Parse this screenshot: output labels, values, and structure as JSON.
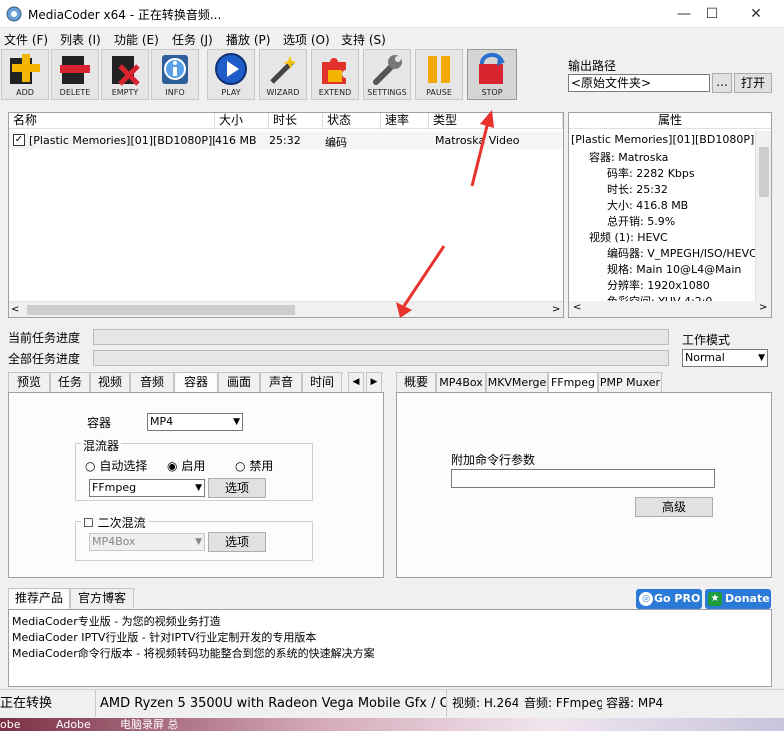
{
  "window": {
    "title": "MediaCoder x64 - 正在转换音频...",
    "controls": {
      "minimize": "—",
      "maximize": "☐",
      "close": "✕"
    }
  },
  "menu": [
    "文件 (F)",
    "列表 (I)",
    "功能 (E)",
    "任务 (J)",
    "播放 (P)",
    "选项 (O)",
    "支持 (S)"
  ],
  "toolbar": [
    {
      "label": "ADD",
      "icon": "add-icon"
    },
    {
      "label": "DELETE",
      "icon": "delete-icon"
    },
    {
      "label": "EMPTY",
      "icon": "empty-icon"
    },
    {
      "label": "INFO",
      "icon": "info-icon"
    },
    {
      "label": "PLAY",
      "icon": "play-icon"
    },
    {
      "label": "WIZARD",
      "icon": "wizard-icon"
    },
    {
      "label": "EXTEND",
      "icon": "puzzle-icon"
    },
    {
      "label": "SETTINGS",
      "icon": "wrench-icon"
    },
    {
      "label": "PAUSE",
      "icon": "pause-icon"
    },
    {
      "label": "STOP",
      "icon": "stop-icon"
    }
  ],
  "output": {
    "label": "输出路径",
    "value": "<原始文件夹>",
    "browse": "...",
    "open": "打开"
  },
  "file_list": {
    "columns": [
      "名称",
      "大小",
      "时长",
      "状态",
      "速率",
      "类型"
    ],
    "rows": [
      {
        "name": "[Plastic Memories][01][BD1080P][...",
        "size": "416 MB",
        "duration": "25:32",
        "status": "编码",
        "rate": "",
        "type": "Matroska Video",
        "checked": true
      }
    ]
  },
  "properties": {
    "header": "属性",
    "root": "[Plastic Memories][01][BD1080P][x265",
    "lines": [
      {
        "indent": 1,
        "text": "容器: Matroska"
      },
      {
        "indent": 2,
        "text": "码率: 2282 Kbps"
      },
      {
        "indent": 2,
        "text": "时长: 25:32"
      },
      {
        "indent": 2,
        "text": "大小: 416.8 MB"
      },
      {
        "indent": 2,
        "text": "总开销: 5.9%"
      },
      {
        "indent": 1,
        "text": "视频 (1): HEVC"
      },
      {
        "indent": 2,
        "text": "编码器: V_MPEGH/ISO/HEVC"
      },
      {
        "indent": 2,
        "text": "规格: Main 10@L4@Main"
      },
      {
        "indent": 2,
        "text": "分辨率: 1920x1080"
      },
      {
        "indent": 2,
        "text": "色彩空间: YUV 4:2:0"
      }
    ]
  },
  "progress": {
    "current_label": "当前任务进度",
    "total_label": "全部任务进度",
    "current_fraction": 0,
    "total_fraction": 0
  },
  "work_mode": {
    "label": "工作模式",
    "value": "Normal"
  },
  "left_tabs": [
    "预览",
    "任务",
    "视频",
    "音频",
    "容器",
    "画面",
    "声音",
    "时间"
  ],
  "left_tabs_active": "容器",
  "container_panel": {
    "container_label": "容器",
    "container_value": "MP4",
    "muxer_group": "混流器",
    "radio_auto": "自动选择",
    "radio_enable": "启用",
    "radio_disable": "禁用",
    "radio_selected": "启用",
    "muxer_value": "FFmpeg",
    "options_button": "选项",
    "second_mux_label": "二次混流",
    "second_mux_value": "MP4Box",
    "second_options_button": "选项"
  },
  "right_tabs": [
    "概要",
    "MP4Box",
    "MKVMerge",
    "FFmpeg",
    "PMP Muxer"
  ],
  "right_tabs_active": "FFmpeg",
  "ffmpeg_panel": {
    "args_label": "附加命令行参数",
    "args_value": "",
    "advanced_button": "高级"
  },
  "bottom_tabs": [
    "推荐产品",
    "官方博客"
  ],
  "bottom_tabs_active": "推荐产品",
  "gopro_button": "Go PRO",
  "donate_button": "Donate",
  "news": [
    "MediaCoder专业版 - 为您的视频业务打造",
    "MediaCoder IPTV行业版 - 针对IPTV行业定制开发的专用版本",
    "MediaCoder命令行版本 - 将视频转码功能整合到您的系统的快速解决方案"
  ],
  "statusbar": {
    "state": "正在转换",
    "cpu": "AMD Ryzen 5 3500U with Radeon Vega Mobile Gfx  / Open",
    "video": "视频: H.264",
    "audio": "音频: FFmpeg",
    "container": "容器: MP4"
  },
  "taskbar": [
    "obe",
    "Adobe",
    "电脑录屏 总"
  ],
  "colors": {
    "accent": "#3074ff",
    "annotation_arrow": "#e8332c",
    "selection": "#cce8ff"
  }
}
